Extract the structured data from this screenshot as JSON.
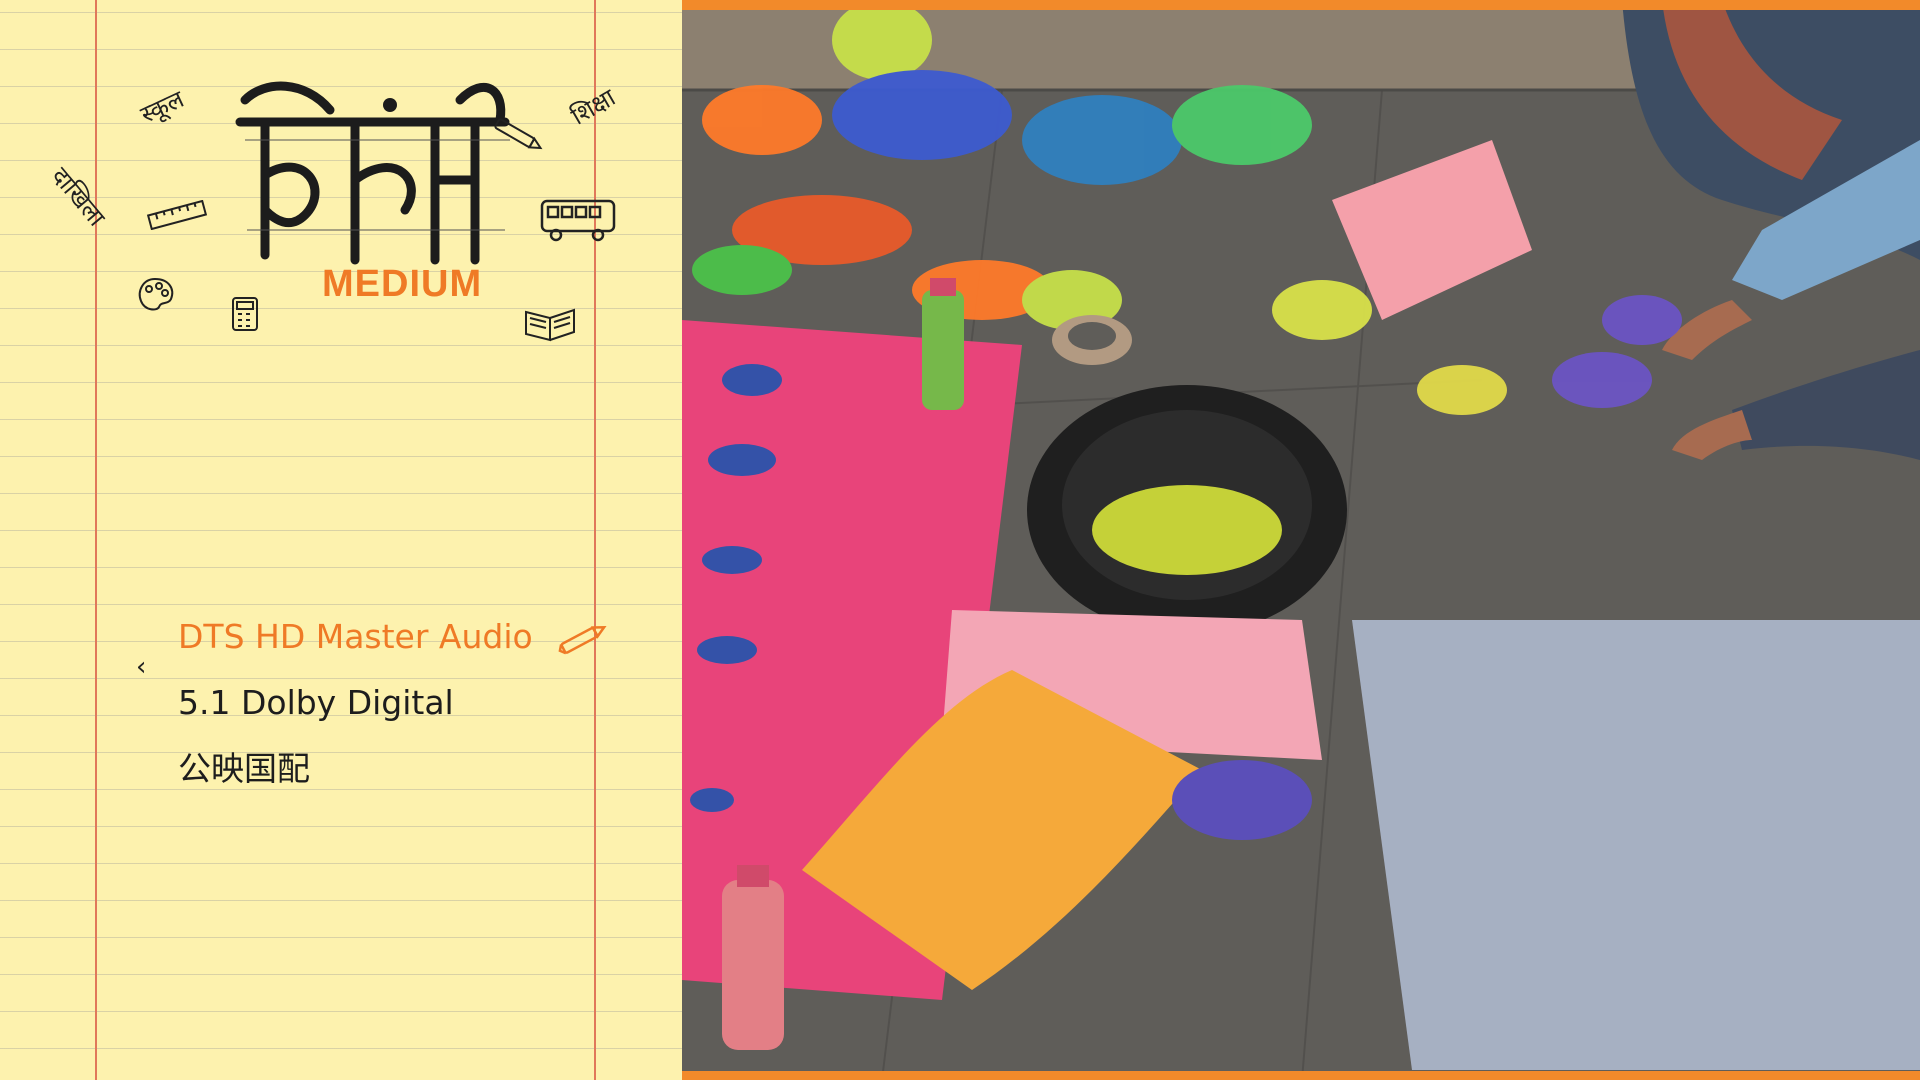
{
  "logo": {
    "title_devanagari": "हिंदी",
    "subtitle": "MEDIUM",
    "doodle_words": [
      "स्कूल",
      "शिक्षा",
      "दाखिला"
    ]
  },
  "audio_menu": {
    "items": [
      {
        "label": "DTS HD Master Audio",
        "selected": true
      },
      {
        "label": "5.1 Dolby Digital",
        "selected": false
      },
      {
        "label": "公映国配",
        "selected": false
      }
    ],
    "back_glyph": "‹"
  },
  "colors": {
    "accent_orange": "#ef7a26",
    "paper": "#fdf2ae",
    "margin_line": "#e0785a",
    "frame_bar": "#f28a2a"
  },
  "icons": [
    "ruler-icon",
    "pen-icon",
    "bus-icon",
    "palette-icon",
    "calculator-icon",
    "book-icon",
    "pencil-icon",
    "back-arrow-icon"
  ]
}
